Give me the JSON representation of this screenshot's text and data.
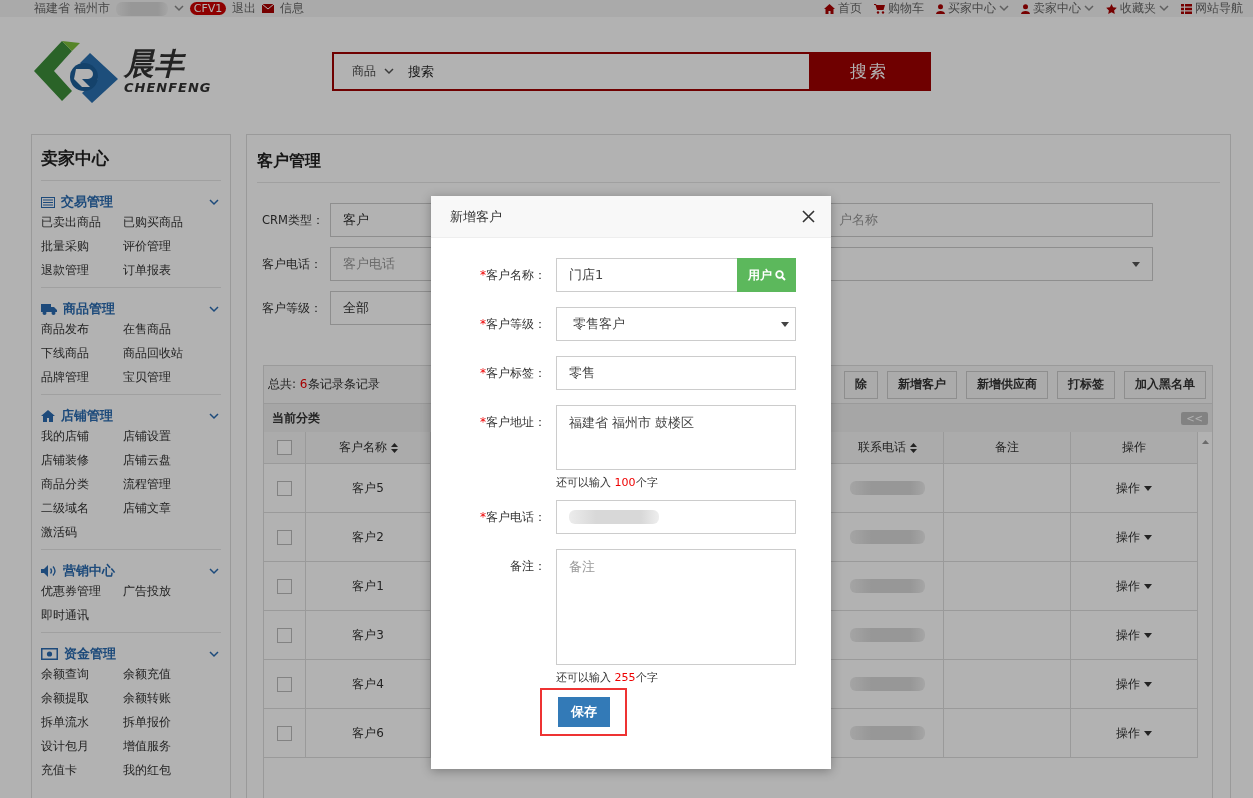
{
  "top_bar": {
    "location": "福建省 福州市",
    "badge": "CFV1",
    "logout": "退出",
    "messages": "信息",
    "nav": [
      {
        "label": "首页",
        "dropdown": false
      },
      {
        "label": "购物车",
        "dropdown": false
      },
      {
        "label": "买家中心",
        "dropdown": true
      },
      {
        "label": "卖家中心",
        "dropdown": true
      },
      {
        "label": "收藏夹",
        "dropdown": true
      },
      {
        "label": "网站导航",
        "dropdown": false
      }
    ]
  },
  "header": {
    "logo_title": "晨丰",
    "logo_subtitle": "CHENFENG",
    "search": {
      "category": "商品",
      "value": "搜索",
      "button": "搜索"
    }
  },
  "sidebar": {
    "title": "卖家中心",
    "sections": [
      {
        "title": "交易管理",
        "expanded": true,
        "items": [
          "已卖出商品",
          "已购买商品",
          "批量采购",
          "评价管理",
          "退款管理",
          "订单报表"
        ]
      },
      {
        "title": "商品管理",
        "expanded": true,
        "items": [
          "商品发布",
          "在售商品",
          "下线商品",
          "商品回收站",
          "品牌管理",
          "宝贝管理"
        ]
      },
      {
        "title": "店铺管理",
        "expanded": true,
        "items": [
          "我的店铺",
          "店铺设置",
          "店铺装修",
          "店铺云盘",
          "商品分类",
          "流程管理",
          "二级域名",
          "店铺文章",
          "激活码"
        ]
      },
      {
        "title": "营销中心",
        "expanded": true,
        "items": [
          "优惠券管理",
          "广告投放",
          "即时通讯"
        ]
      },
      {
        "title": "资金管理",
        "expanded": true,
        "items": [
          "余额查询",
          "余额充值",
          "余额提取",
          "余额转账",
          "拆单流水",
          "拆单报价",
          "设计包月",
          "增值服务",
          "充值卡",
          "我的红包"
        ]
      }
    ]
  },
  "main": {
    "title": "客户管理",
    "filters": [
      {
        "label": "CRM类型：",
        "kind": "select",
        "value": "客户"
      },
      {
        "label": "客户电话：",
        "kind": "input",
        "placeholder": "客户电话"
      },
      {
        "label": "客户等级：",
        "kind": "select",
        "value": "全部"
      }
    ],
    "filters_right": [
      {
        "kind": "input",
        "placeholder": "户名称"
      },
      {
        "kind": "select"
      }
    ],
    "total": {
      "prefix": "总共: ",
      "count": "6",
      "suffix": "条记录条记录"
    },
    "actions": [
      "除",
      "新增客户",
      "新增供应商",
      "打标签",
      "加入黑名单"
    ],
    "category_bar": {
      "label": "当前分类",
      "collapse": "<<"
    },
    "table": {
      "header_checked": false,
      "columns": [
        {
          "label": "客户名称",
          "sortable": true
        },
        {
          "label": "联系电话",
          "sortable": true
        },
        {
          "label": "备注",
          "sortable": false
        },
        {
          "label": "操作",
          "sortable": false
        }
      ],
      "rows": [
        {
          "checked": false,
          "name": "客户5",
          "action": "操作"
        },
        {
          "checked": false,
          "name": "客户2",
          "action": "操作"
        },
        {
          "checked": false,
          "name": "客户1",
          "action": "操作"
        },
        {
          "checked": false,
          "name": "客户3",
          "action": "操作"
        },
        {
          "checked": false,
          "name": "客户4",
          "action": "操作"
        },
        {
          "checked": false,
          "name": "客户6",
          "action": "操作"
        }
      ]
    }
  },
  "dialog": {
    "title": "新增客户",
    "fields": [
      {
        "kind": "input-button",
        "required_mark": "*",
        "label": "客户名称：",
        "value": "门店1",
        "button": "用户"
      },
      {
        "kind": "select",
        "required_mark": "*",
        "label": "客户等级：",
        "value": "零售客户"
      },
      {
        "kind": "input",
        "required_mark": "*",
        "label": "客户标签：",
        "value": "零售"
      },
      {
        "kind": "textarea",
        "required_mark": "*",
        "label": "客户地址：",
        "value": "福建省 福州市 鼓楼区",
        "hint": {
          "prefix": "还可以输入 ",
          "count": "100",
          "suffix": "个字"
        }
      },
      {
        "kind": "redacted",
        "required_mark": "*",
        "label": "客户电话："
      },
      {
        "kind": "textarea",
        "label": "备注：",
        "placeholder": "备注",
        "hint": {
          "prefix": "还可以输入 ",
          "count": "255",
          "suffix": "个字"
        }
      }
    ],
    "save": "保存",
    "save_highlighted": true
  }
}
